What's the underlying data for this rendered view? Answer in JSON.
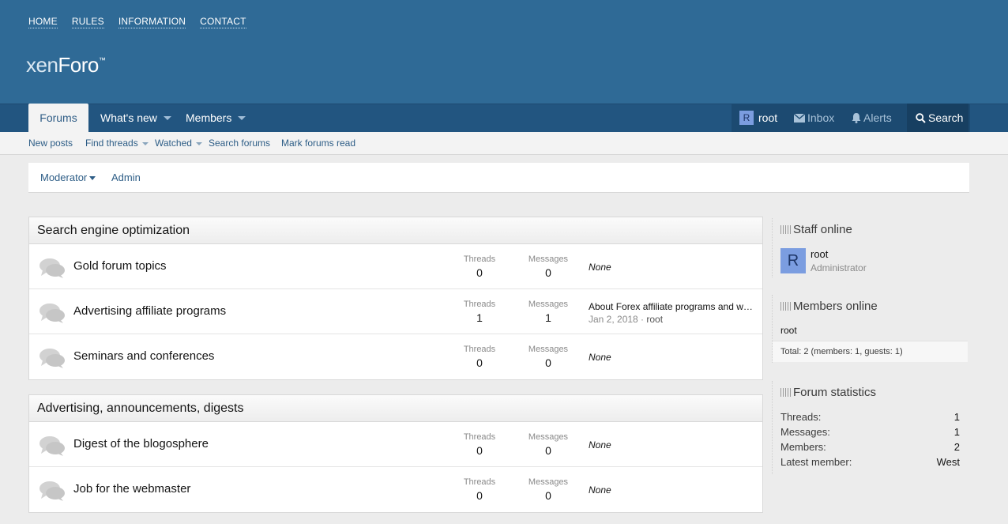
{
  "header": {
    "top_links": [
      "HOME",
      "RULES",
      "INFORMATION",
      "CONTACT"
    ],
    "logo_part1": "xen",
    "logo_part2": "Foro",
    "logo_tm": "™"
  },
  "nav": {
    "forums": "Forums",
    "whats_new": "What's new",
    "members": "Members",
    "user": "root",
    "user_initial": "R",
    "inbox": "Inbox",
    "alerts": "Alerts",
    "search": "Search"
  },
  "subnav": {
    "new_posts": "New posts",
    "find_threads": "Find threads",
    "watched": "Watched",
    "search_forums": "Search forums",
    "mark_read": "Mark forums read"
  },
  "staffbar": {
    "moderator": "Moderator",
    "admin": "Admin"
  },
  "labels": {
    "threads": "Threads",
    "messages": "Messages",
    "none": "None"
  },
  "categories": [
    {
      "title": "Search engine optimization",
      "forums": [
        {
          "title": "Gold forum topics",
          "threads": "0",
          "messages": "0",
          "latest": null
        },
        {
          "title": "Advertising affiliate programs",
          "threads": "1",
          "messages": "1",
          "latest": {
            "title": "About Forex affiliate programs and what they can give you",
            "date": "Jan 2, 2018",
            "sep": " · ",
            "user": "root"
          }
        },
        {
          "title": "Seminars and conferences",
          "threads": "0",
          "messages": "0",
          "latest": null
        }
      ]
    },
    {
      "title": "Advertising, announcements, digests",
      "forums": [
        {
          "title": "Digest of the blogosphere",
          "threads": "0",
          "messages": "0",
          "latest": null
        },
        {
          "title": "Job for the webmaster",
          "threads": "0",
          "messages": "0",
          "latest": null
        }
      ]
    }
  ],
  "sidebar": {
    "staff_online": {
      "title": "Staff online",
      "name": "root",
      "initial": "R",
      "role": "Administrator"
    },
    "members_online": {
      "title": "Members online",
      "name": "root",
      "total": "Total: 2 (members: 1, guests: 1)"
    },
    "forum_stats": {
      "title": "Forum statistics",
      "rows": [
        {
          "label": "Threads:",
          "value": "1"
        },
        {
          "label": "Messages:",
          "value": "1"
        },
        {
          "label": "Members:",
          "value": "2"
        },
        {
          "label": "Latest member:",
          "value": "West"
        }
      ]
    }
  },
  "colors": {
    "header_bg": "#2f6a96",
    "nav_bg": "#225580",
    "link": "#2d5d86",
    "avatar": "#7b9de0"
  }
}
